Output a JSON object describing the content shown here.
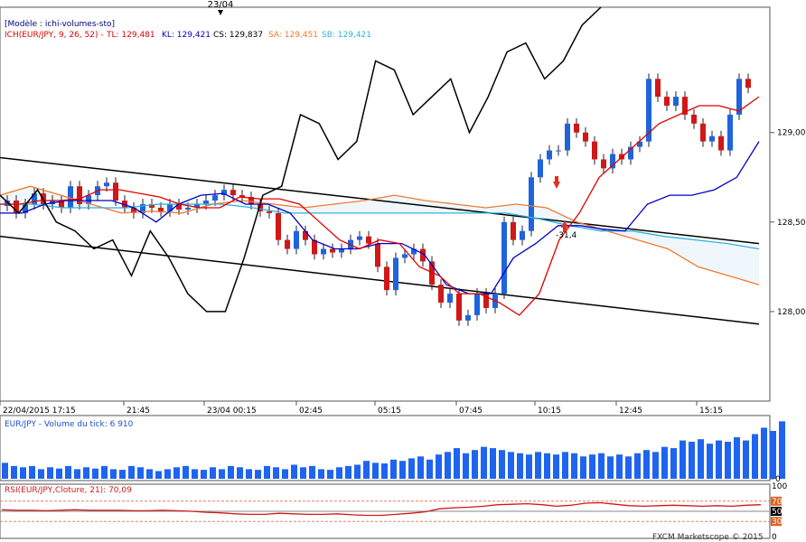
{
  "header": {
    "top_date_marker": "23/04",
    "model_line": "[Modèle : ichi-volumes-sto]",
    "ichimoku_name": "ICH(EUR/JPY, 9, 26, 52) -",
    "tl": "TL: 129,481",
    "kl": "KL: 129,421",
    "cs": "CS: 129,837",
    "sa": "SA: 129,451",
    "sb": "SB: 129,421"
  },
  "annotation": "-31,4",
  "volume_title": "EUR/JPY - Volume du tick: 6 910",
  "rsi_title": "RSI(EUR/JPY,Cloture, 21): 70,09",
  "footer": "FXCM Marketscope © 2015",
  "colors": {
    "tenkan": "#e00000",
    "kijun": "#0000c8",
    "chikou": "#000000",
    "senkou_a": "#f07a30",
    "senkou_b": "#30b0e0",
    "bull": "#1e64dc",
    "bear": "#d01818",
    "volume": "#1e64f0",
    "rsi": "#d01818"
  },
  "chart_data": {
    "type": "line",
    "instrument": "EUR/JPY",
    "x_tick_labels": [
      "22/04/2015 17:15",
      "21:45",
      "23/04 00:15",
      "02:45",
      "05:15",
      "07:45",
      "10:15",
      "12:45",
      "15:15"
    ],
    "price_axis_labels": [
      "129,00",
      "128,50",
      "128,00"
    ],
    "price_ylim": [
      127.5,
      129.7
    ],
    "candles_close": [
      128.62,
      128.55,
      128.6,
      128.66,
      128.6,
      128.62,
      128.58,
      128.7,
      128.6,
      128.65,
      128.7,
      128.72,
      128.62,
      128.58,
      128.55,
      128.6,
      128.58,
      128.56,
      128.6,
      128.57,
      128.58,
      128.6,
      128.62,
      128.65,
      128.68,
      128.65,
      128.64,
      128.6,
      128.56,
      128.55,
      128.4,
      128.35,
      128.45,
      128.4,
      128.32,
      128.35,
      128.33,
      128.35,
      128.4,
      128.42,
      128.38,
      128.25,
      128.12,
      128.3,
      128.32,
      128.35,
      128.28,
      128.15,
      128.05,
      128.1,
      127.95,
      127.98,
      128.1,
      128.02,
      128.1,
      128.5,
      128.4,
      128.45,
      128.75,
      128.85,
      128.9,
      128.9,
      129.05,
      129.0,
      128.95,
      128.85,
      128.8,
      128.88,
      128.85,
      128.92,
      128.95,
      129.3,
      129.2,
      129.15,
      129.2,
      129.1,
      129.05,
      128.95,
      128.98,
      128.9,
      129.1,
      129.3,
      129.25
    ],
    "tenkan": [
      128.6,
      128.6,
      128.62,
      128.62,
      128.63,
      128.68,
      128.68,
      128.66,
      128.64,
      128.6,
      128.58,
      128.58,
      128.64,
      128.63,
      128.63,
      128.6,
      128.5,
      128.4,
      128.35,
      128.4,
      128.38,
      128.25,
      128.2,
      128.1,
      128.1,
      128.05,
      127.98,
      128.1,
      128.4,
      128.55,
      128.75,
      128.85,
      128.95,
      129.05,
      129.1,
      129.15,
      129.15,
      129.12,
      129.2
    ],
    "kijun": [
      128.55,
      128.55,
      128.6,
      128.62,
      128.62,
      128.62,
      128.58,
      128.5,
      128.6,
      128.65,
      128.66,
      128.6,
      128.6,
      128.55,
      128.4,
      128.35,
      128.35,
      128.38,
      128.38,
      128.32,
      128.15,
      128.1,
      128.1,
      128.3,
      128.38,
      128.48,
      128.48,
      128.46,
      128.45,
      128.6,
      128.65,
      128.65,
      128.68,
      128.75,
      128.95
    ],
    "chikou": [
      128.65,
      128.55,
      128.68,
      128.5,
      128.45,
      128.35,
      128.4,
      128.2,
      128.45,
      128.3,
      128.1,
      128.0,
      128.0,
      128.3,
      128.65,
      128.7,
      129.1,
      129.05,
      128.85,
      128.95,
      129.4,
      129.35,
      129.1,
      129.2,
      129.3,
      129.0,
      129.2,
      129.45,
      129.5,
      129.3,
      129.4,
      129.6,
      129.7
    ],
    "senkou_a": [
      128.65,
      128.7,
      128.65,
      128.6,
      128.55,
      128.56,
      128.55,
      128.6,
      128.62,
      128.6,
      128.58,
      128.6,
      128.62,
      128.65,
      128.62,
      128.6,
      128.58,
      128.6,
      128.58,
      128.5,
      128.45,
      128.4,
      128.35,
      128.25,
      128.2,
      128.15
    ],
    "senkou_b": [
      128.6,
      128.6,
      128.58,
      128.58,
      128.58,
      128.6,
      128.6,
      128.6,
      128.58,
      128.55,
      128.55,
      128.55,
      128.55,
      128.55,
      128.55,
      128.55,
      128.55,
      128.52,
      128.48,
      128.45,
      128.45,
      128.42,
      128.4,
      128.38,
      128.35
    ],
    "volume_axis_labels": [
      "0"
    ],
    "volume": [
      25,
      20,
      18,
      20,
      15,
      18,
      16,
      20,
      15,
      18,
      16,
      20,
      15,
      14,
      20,
      18,
      15,
      12,
      15,
      18,
      20,
      15,
      14,
      18,
      15,
      20,
      18,
      15,
      14,
      20,
      18,
      15,
      22,
      18,
      20,
      15,
      14,
      18,
      20,
      22,
      28,
      25,
      24,
      30,
      28,
      32,
      35,
      30,
      38,
      42,
      48,
      40,
      45,
      50,
      48,
      45,
      42,
      40,
      38,
      42,
      40,
      38,
      42,
      40,
      35,
      38,
      40,
      35,
      38,
      35,
      40,
      45,
      42,
      50,
      48,
      60,
      58,
      62,
      55,
      60,
      58,
      65,
      60,
      70,
      80,
      75,
      90
    ],
    "rsi_axis_labels": [
      "100",
      "70",
      "50",
      "30",
      "0"
    ],
    "rsi_levels": [
      70,
      50,
      30
    ],
    "rsi": [
      53,
      52,
      52,
      51,
      52,
      53,
      52,
      52,
      52,
      51,
      51,
      52,
      51,
      50,
      48,
      47,
      45,
      44,
      44,
      46,
      45,
      44,
      44,
      45,
      43,
      42,
      42,
      44,
      46,
      49,
      55,
      57,
      58,
      60,
      63,
      64,
      65,
      63,
      60,
      62,
      66,
      67,
      64,
      61,
      60,
      61,
      62,
      61,
      60,
      61,
      60,
      62,
      63
    ]
  }
}
